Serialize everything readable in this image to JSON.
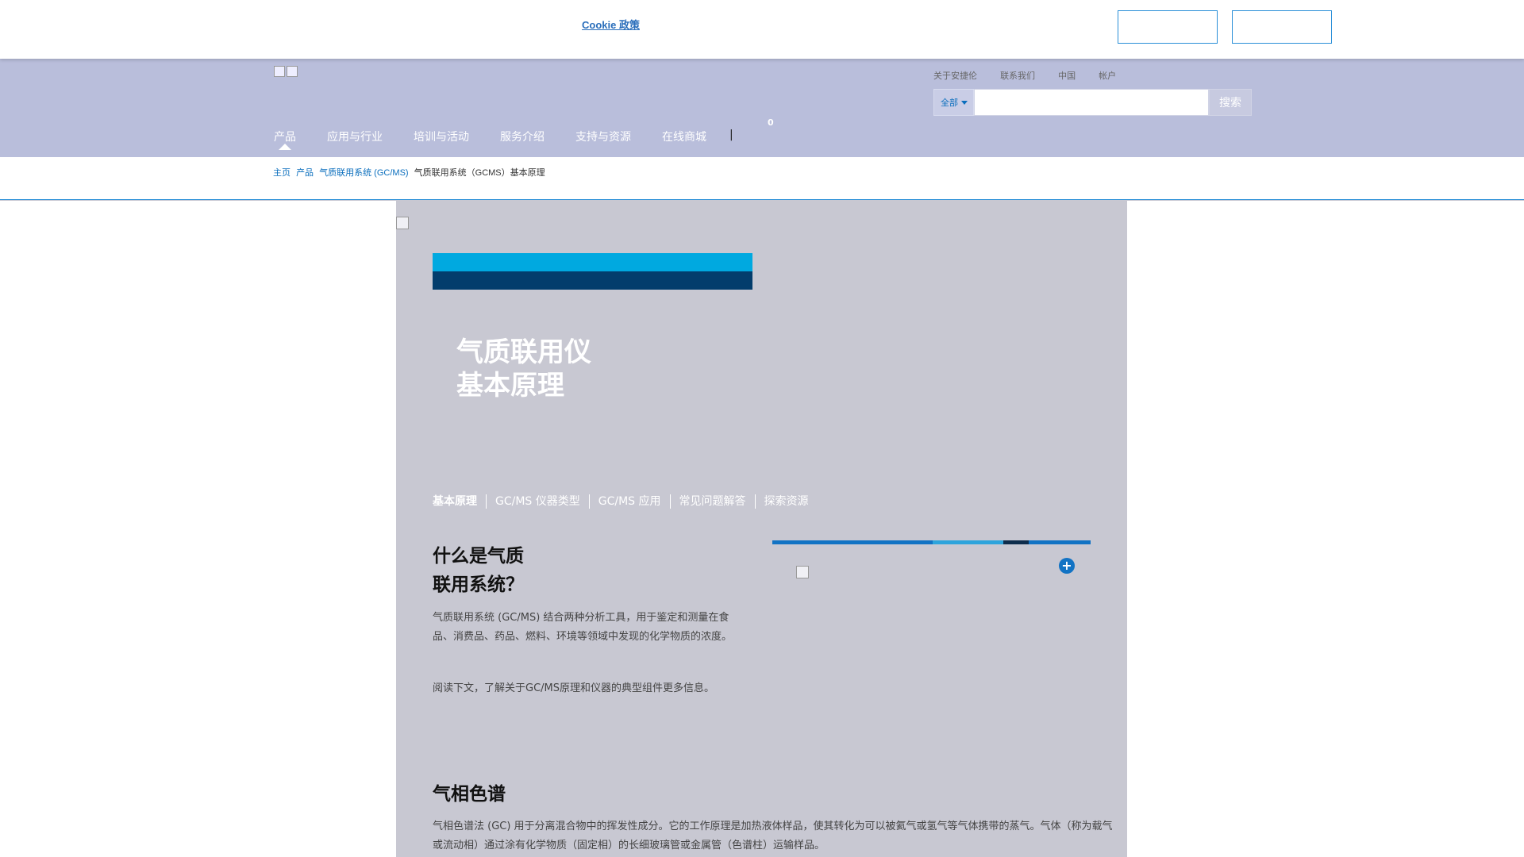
{
  "cookie_bar": {
    "policy_link": "Cookie 政策",
    "button_1": "",
    "button_2": ""
  },
  "header": {
    "utility_links": [
      "关于安捷伦",
      "联系我们",
      " 中国",
      "帐户"
    ],
    "search": {
      "scope": "全部",
      "placeholder": "",
      "button": "搜索"
    },
    "nav": [
      "产品",
      "应用与行业",
      "培训与活动",
      "服务介绍",
      "支持与资源",
      "在线商城"
    ],
    "nav_divider": "|",
    "cart_count": "0"
  },
  "breadcrumb": {
    "items": [
      "主页",
      "产品",
      "气质联用系统 (GC/MS)"
    ],
    "separator": "",
    "current": "气质联用系统（GCMS）基本原理"
  },
  "hero": {
    "title_line1": "气质联用仪",
    "title_line2": "基本原理"
  },
  "tabs": [
    "基本原理",
    "GC/MS 仪器类型",
    "GC/MS 应用",
    "常见问题解答",
    "探索资源"
  ],
  "section1": {
    "title_line1": "什么是气质",
    "title_line2": "联用系统？",
    "para1": "气质联用系统 (GC/MS) 结合两种分析工具，用于鉴定和测量在食品、消费品、药品、燃料、环境等领域中发现的化学物质的浓度。",
    "para2": "阅读下文，了解关于GC/MS原理和仪器的典型组件更多信息。",
    "expand_symbol": "+"
  },
  "section2": {
    "title": "气相色谱",
    "para": "气相色谱法 (GC) 用于分离混合物中的挥发性成分。它的工作原理是加热液体样品，使其转化为可以被氦气或氢气等气体携带的蒸气。气体（称为载气或流动相）通过涂有化学物质（固定相）的长细玻璃管或金属管（色谱柱）运输样品。"
  },
  "colors": {
    "accent_blue": "#00a9e0",
    "navy": "#033d6c",
    "link": "#0a6ebd",
    "header_bg": "#b9bedb"
  }
}
